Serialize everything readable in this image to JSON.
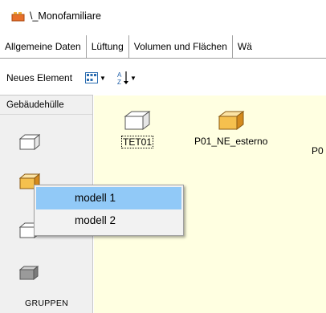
{
  "window": {
    "title": "\\_Monofamiliare"
  },
  "tabs": [
    {
      "label": "Allgemeine Daten",
      "underline_char": "D"
    },
    {
      "label": "Lüftung",
      "underline_char": "L"
    },
    {
      "label": "Volumen und Flächen",
      "underline_char": "V"
    },
    {
      "label": "Wä"
    }
  ],
  "toolbar": {
    "new_element_label": "Neues Element"
  },
  "sidebar": {
    "header": "Gebäudehülle",
    "footer": "GRUPPEN"
  },
  "elements": [
    {
      "label": "TET01"
    },
    {
      "label": "P01_NE_esterno"
    },
    {
      "label": "P0"
    }
  ],
  "context_menu": {
    "items": [
      {
        "label": "modell 1",
        "selected": true
      },
      {
        "label": "modell 2",
        "selected": false
      }
    ]
  }
}
